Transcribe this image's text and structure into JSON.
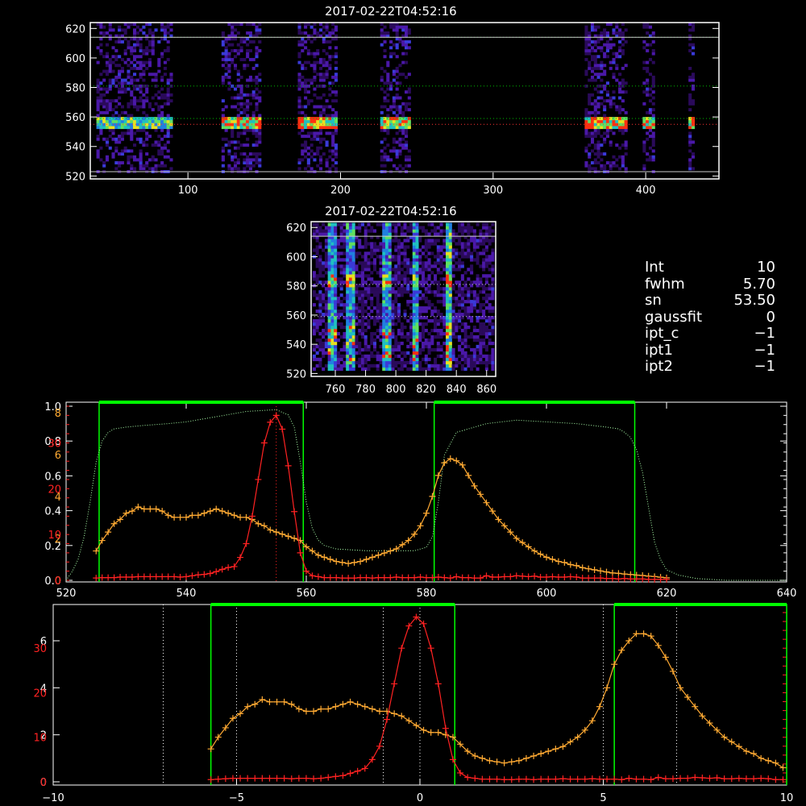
{
  "panels": {
    "top": {
      "title": "2017-02-22T04:52:16",
      "x_ticks": [
        "100",
        "200",
        "300",
        "400"
      ],
      "y_ticks": [
        "520",
        "540",
        "560",
        "580",
        "600",
        "620"
      ]
    },
    "mid": {
      "title": "2017-02-22T04:52:16",
      "x_ticks": [
        "760",
        "780",
        "800",
        "820",
        "840",
        "860"
      ],
      "y_ticks": [
        "520",
        "540",
        "560",
        "580",
        "600",
        "620"
      ]
    }
  },
  "info": [
    {
      "key": "Int",
      "value": "10"
    },
    {
      "key": "fwhm",
      "value": "5.70"
    },
    {
      "key": "sn",
      "value": "53.50"
    },
    {
      "key": "gaussfit",
      "value": "0"
    },
    {
      "key": "ipt_c",
      "value": "−1"
    },
    {
      "key": "ipt1",
      "value": "−1"
    },
    {
      "key": "ipt2",
      "value": "−1"
    }
  ],
  "colors": {
    "background": "#000000",
    "axes": "#ffffff",
    "filter_box": "#00ff00",
    "filter_curve": "#aaffaa",
    "series_orange": "#ffaa33",
    "series_red": "#ff2222",
    "grid_green": "#00bb00",
    "grid_red": "#ff3333",
    "grid_white": "#ffffff"
  },
  "chart_data": [
    {
      "type": "heatmap",
      "title": "2017-02-22T04:52:16",
      "xlim": [
        36,
        448
      ],
      "ylim": [
        518,
        624
      ],
      "x_ticks": [
        100,
        200,
        300,
        400
      ],
      "y_ticks": [
        520,
        540,
        560,
        580,
        600,
        620
      ],
      "columns": [
        [
          40,
          90
        ],
        [
          122,
          148
        ],
        [
          172,
          198
        ],
        [
          226,
          246
        ],
        [
          360,
          388
        ],
        [
          398,
          406
        ],
        [
          428,
          432
        ]
      ],
      "bright_row": 555,
      "guide_lines_green": [
        614,
        581,
        559
      ],
      "guide_line_red": 555,
      "guide_lines_white": [
        614,
        581
      ]
    },
    {
      "type": "heatmap",
      "title": "2017-02-22T04:52:16",
      "xlim": [
        744,
        866
      ],
      "ylim": [
        518,
        624
      ],
      "x_ticks": [
        760,
        780,
        800,
        820,
        840,
        860
      ],
      "y_ticks": [
        520,
        540,
        560,
        580,
        600,
        620
      ],
      "streaks": [
        757,
        769,
        793,
        812,
        834
      ],
      "guide_lines": [
        614,
        581,
        559
      ]
    },
    {
      "type": "line",
      "xlim": [
        520,
        640
      ],
      "x_ticks": [
        520,
        540,
        560,
        580,
        600,
        620,
        640
      ],
      "y_left_white": {
        "ticks": [
          "0.0",
          "0.2",
          "0.4",
          "0.6",
          "0.8",
          "1.0"
        ],
        "range": [
          0,
          1.0
        ]
      },
      "y_left_orange": {
        "ticks": [
          "0",
          "2",
          "4",
          "6",
          "8"
        ],
        "range": [
          0,
          8.3
        ]
      },
      "y_left_red": {
        "ticks": [
          "0",
          "10",
          "20",
          "30"
        ],
        "range": [
          0,
          38
        ]
      },
      "filter_boxes": [
        [
          525.5,
          559.5
        ],
        [
          581.3,
          614.7
        ]
      ],
      "center_marker": 555,
      "series": [
        {
          "color": "orange",
          "x": [
            525,
            526,
            527,
            528,
            529,
            530,
            531,
            532,
            533,
            534,
            535,
            536,
            537,
            538,
            539,
            540,
            541,
            542,
            543,
            544,
            545,
            546,
            547,
            548,
            549,
            550,
            551,
            552,
            553,
            554,
            555,
            556,
            557,
            558,
            559,
            560,
            561,
            562,
            563,
            564,
            565,
            566,
            567,
            568,
            569,
            570,
            571,
            572,
            573,
            574,
            575,
            576,
            577,
            578,
            579,
            580,
            581,
            582,
            583,
            584,
            585,
            586,
            587,
            588,
            589,
            590,
            591,
            592,
            593,
            594,
            595,
            596,
            597,
            598,
            599,
            600,
            601,
            602,
            603,
            604,
            605,
            606,
            607,
            608,
            609,
            610,
            611,
            612,
            613,
            614,
            615,
            616,
            617,
            618,
            619,
            620
          ],
          "values": [
            1.4,
            1.9,
            2.3,
            2.7,
            2.9,
            3.2,
            3.3,
            3.5,
            3.4,
            3.4,
            3.4,
            3.3,
            3.1,
            3.0,
            3.0,
            3.0,
            3.1,
            3.1,
            3.2,
            3.3,
            3.4,
            3.3,
            3.2,
            3.1,
            3.0,
            3.0,
            2.9,
            2.7,
            2.6,
            2.4,
            2.3,
            2.2,
            2.1,
            2.0,
            1.9,
            1.6,
            1.4,
            1.2,
            1.1,
            1.0,
            0.9,
            0.85,
            0.8,
            0.85,
            0.9,
            1.0,
            1.1,
            1.2,
            1.3,
            1.4,
            1.5,
            1.7,
            1.9,
            2.2,
            2.6,
            3.2,
            4.0,
            5.0,
            5.6,
            5.8,
            5.7,
            5.5,
            5.0,
            4.5,
            4.1,
            3.7,
            3.3,
            2.9,
            2.6,
            2.3,
            2.0,
            1.8,
            1.6,
            1.4,
            1.25,
            1.1,
            1.0,
            0.9,
            0.85,
            0.75,
            0.7,
            0.6,
            0.55,
            0.5,
            0.45,
            0.4,
            0.35,
            0.33,
            0.3,
            0.28,
            0.25,
            0.23,
            0.2,
            0.18,
            0.15,
            0.12
          ]
        },
        {
          "color": "red",
          "x": [
            525,
            526,
            527,
            528,
            529,
            530,
            531,
            532,
            533,
            534,
            535,
            536,
            537,
            538,
            539,
            540,
            541,
            542,
            543,
            544,
            545,
            546,
            547,
            548,
            549,
            550,
            551,
            552,
            553,
            554,
            555,
            556,
            557,
            558,
            559,
            560,
            561,
            562,
            563,
            564,
            565,
            566,
            567,
            568,
            569,
            570,
            571,
            572,
            573,
            574,
            575,
            576,
            577,
            578,
            579,
            580,
            581,
            582,
            583,
            584,
            585,
            586,
            587,
            588,
            589,
            590,
            591,
            592,
            593,
            594,
            595,
            596,
            597,
            598,
            599,
            600,
            601,
            602,
            603,
            604,
            605,
            606,
            607,
            608,
            609,
            610,
            611,
            612,
            613,
            614,
            615,
            616,
            617,
            618,
            619,
            620
          ],
          "values": [
            0.5,
            0.6,
            0.6,
            0.6,
            0.7,
            0.7,
            0.7,
            0.8,
            0.8,
            0.8,
            0.8,
            0.8,
            0.8,
            0.8,
            0.7,
            0.8,
            1.0,
            1.2,
            1.3,
            1.5,
            1.9,
            2.4,
            2.8,
            3.0,
            5.0,
            8.0,
            14.0,
            22.0,
            30.0,
            34.5,
            36.0,
            33.0,
            25.0,
            15.0,
            6.0,
            2.0,
            1.0,
            0.8,
            0.6,
            0.6,
            0.6,
            0.5,
            0.5,
            0.5,
            0.6,
            0.6,
            0.5,
            0.6,
            0.6,
            0.6,
            0.7,
            0.6,
            0.6,
            0.6,
            0.7,
            0.6,
            0.6,
            0.7,
            0.6,
            0.5,
            0.8,
            0.6,
            0.6,
            0.5,
            0.5,
            1.0,
            0.7,
            0.7,
            0.8,
            0.8,
            1.0,
            0.9,
            0.8,
            0.9,
            0.7,
            0.7,
            0.8,
            0.7,
            0.7,
            0.8,
            0.7,
            0.5,
            0.5,
            0.5,
            0.5,
            0.4,
            0.4,
            0.3,
            0.4,
            0.3,
            0.3,
            0.3,
            0.2,
            0.2,
            0.2,
            0.2
          ]
        },
        {
          "color": "filter",
          "x": [
            520,
            521,
            522,
            523,
            524,
            525,
            526,
            527,
            528,
            530,
            533,
            537,
            540,
            545,
            550,
            555,
            557,
            558,
            559,
            560,
            561,
            562,
            563,
            565,
            570,
            575,
            578,
            580,
            581,
            582,
            583,
            585,
            590,
            595,
            600,
            605,
            610,
            612,
            613,
            614,
            615,
            616,
            617,
            618,
            619,
            620,
            622,
            625,
            630,
            635,
            640
          ],
          "values": [
            0.0,
            0.05,
            0.12,
            0.25,
            0.45,
            0.68,
            0.8,
            0.85,
            0.87,
            0.88,
            0.89,
            0.9,
            0.91,
            0.94,
            0.97,
            0.98,
            0.95,
            0.88,
            0.68,
            0.45,
            0.3,
            0.23,
            0.2,
            0.18,
            0.17,
            0.17,
            0.17,
            0.19,
            0.25,
            0.45,
            0.72,
            0.85,
            0.9,
            0.92,
            0.91,
            0.9,
            0.88,
            0.87,
            0.85,
            0.82,
            0.75,
            0.62,
            0.42,
            0.22,
            0.12,
            0.06,
            0.03,
            0.01,
            0.0,
            0.0,
            0.0
          ]
        }
      ]
    },
    {
      "type": "line",
      "xlim": [
        -10,
        10
      ],
      "x_ticks": [
        -10,
        -5,
        0,
        5,
        10
      ],
      "y_left_white": {
        "ticks": [
          "0",
          "2",
          "4",
          "6"
        ],
        "range": [
          0,
          7.2
        ]
      },
      "y_left_red": {
        "ticks": [
          "0",
          "10",
          "20",
          "30"
        ],
        "range": [
          0,
          38
        ]
      },
      "filter_boxes": [
        [
          -5.7,
          0.95
        ],
        [
          5.3,
          10
        ]
      ],
      "white_dotted_lines": [
        -7,
        -5,
        -1,
        0,
        5,
        7
      ],
      "series": [
        {
          "color": "orange",
          "x": [
            -5.7,
            -5.5,
            -5.3,
            -5.1,
            -4.9,
            -4.7,
            -4.5,
            -4.3,
            -4.1,
            -3.9,
            -3.7,
            -3.5,
            -3.3,
            -3.1,
            -2.9,
            -2.7,
            -2.5,
            -2.3,
            -2.1,
            -1.9,
            -1.7,
            -1.5,
            -1.3,
            -1.1,
            -0.9,
            -0.7,
            -0.5,
            -0.3,
            -0.1,
            0.1,
            0.3,
            0.5,
            0.7,
            0.9,
            1.1,
            1.3,
            1.5,
            1.7,
            1.9,
            2.1,
            2.3,
            2.5,
            2.7,
            2.9,
            3.1,
            3.3,
            3.5,
            3.7,
            3.9,
            4.1,
            4.3,
            4.5,
            4.7,
            4.9,
            5.1,
            5.3,
            5.5,
            5.7,
            5.9,
            6.1,
            6.3,
            6.5,
            6.7,
            6.9,
            7.1,
            7.3,
            7.5,
            7.7,
            7.9,
            8.1,
            8.3,
            8.5,
            8.7,
            8.9,
            9.1,
            9.3,
            9.5,
            9.7,
            9.9
          ],
          "values": [
            1.4,
            1.9,
            2.3,
            2.7,
            2.9,
            3.2,
            3.3,
            3.5,
            3.4,
            3.4,
            3.4,
            3.3,
            3.1,
            3.0,
            3.0,
            3.1,
            3.1,
            3.2,
            3.3,
            3.4,
            3.3,
            3.2,
            3.1,
            3.0,
            3.0,
            2.9,
            2.8,
            2.6,
            2.4,
            2.2,
            2.1,
            2.1,
            2.0,
            1.9,
            1.6,
            1.3,
            1.1,
            1.0,
            0.9,
            0.85,
            0.8,
            0.85,
            0.9,
            1.0,
            1.1,
            1.2,
            1.3,
            1.4,
            1.5,
            1.7,
            1.9,
            2.2,
            2.6,
            3.2,
            4.0,
            5.0,
            5.6,
            6.0,
            6.3,
            6.3,
            6.2,
            5.8,
            5.3,
            4.7,
            4.0,
            3.6,
            3.2,
            2.8,
            2.5,
            2.2,
            1.9,
            1.7,
            1.5,
            1.3,
            1.2,
            1.0,
            0.9,
            0.8,
            0.6
          ]
        },
        {
          "color": "red",
          "x": [
            -5.7,
            -5.5,
            -5.3,
            -5.1,
            -4.9,
            -4.7,
            -4.5,
            -4.3,
            -4.1,
            -3.9,
            -3.7,
            -3.5,
            -3.3,
            -3.1,
            -2.9,
            -2.7,
            -2.5,
            -2.3,
            -2.1,
            -1.9,
            -1.7,
            -1.5,
            -1.3,
            -1.1,
            -0.9,
            -0.7,
            -0.5,
            -0.3,
            -0.1,
            0.1,
            0.3,
            0.5,
            0.7,
            0.9,
            1.1,
            1.3,
            1.5,
            1.7,
            1.9,
            2.1,
            2.3,
            2.5,
            2.7,
            2.9,
            3.1,
            3.3,
            3.5,
            3.7,
            3.9,
            4.1,
            4.3,
            4.5,
            4.7,
            4.9,
            5.1,
            5.3,
            5.5,
            5.7,
            5.9,
            6.1,
            6.3,
            6.5,
            6.7,
            6.9,
            7.1,
            7.3,
            7.5,
            7.7,
            7.9,
            8.1,
            8.3,
            8.5,
            8.7,
            8.9,
            9.1,
            9.3,
            9.5,
            9.7,
            9.9
          ],
          "values": [
            0.5,
            0.6,
            0.7,
            0.8,
            0.8,
            0.8,
            0.8,
            0.8,
            0.8,
            0.8,
            0.8,
            0.7,
            0.8,
            0.8,
            0.7,
            0.8,
            1.0,
            1.2,
            1.4,
            1.9,
            2.4,
            3.0,
            5.0,
            8.0,
            14.0,
            22.0,
            30.0,
            35.0,
            37.0,
            35.5,
            30.0,
            22.0,
            12.0,
            5.0,
            2.0,
            1.0,
            0.8,
            0.6,
            0.6,
            0.6,
            0.5,
            0.5,
            0.6,
            0.6,
            0.5,
            0.6,
            0.6,
            0.6,
            0.7,
            0.6,
            0.6,
            0.6,
            0.7,
            0.6,
            0.6,
            0.6,
            0.5,
            0.8,
            0.6,
            0.6,
            0.5,
            1.0,
            0.7,
            0.7,
            0.8,
            0.8,
            1.0,
            0.9,
            0.8,
            0.9,
            0.7,
            0.7,
            0.8,
            0.7,
            0.7,
            0.8,
            0.7,
            0.5,
            0.5
          ]
        }
      ]
    }
  ]
}
